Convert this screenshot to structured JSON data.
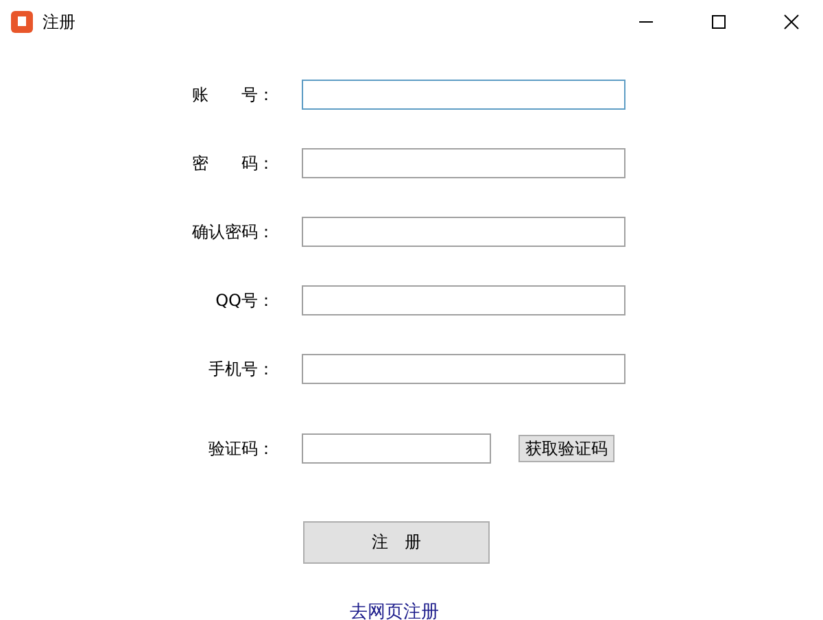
{
  "window": {
    "title": "注册"
  },
  "fields": [
    {
      "label": "账　　号：",
      "focused": true
    },
    {
      "label": "密　　码：",
      "focused": false
    },
    {
      "label": "确认密码：",
      "focused": false
    },
    {
      "label": "QQ号：",
      "focused": false
    },
    {
      "label": "手机号：",
      "focused": false
    }
  ],
  "code_field": {
    "label": "验证码：",
    "focused": false,
    "button": "获取验证码"
  },
  "submit_button": "注　册",
  "web_link": "去网页注册"
}
